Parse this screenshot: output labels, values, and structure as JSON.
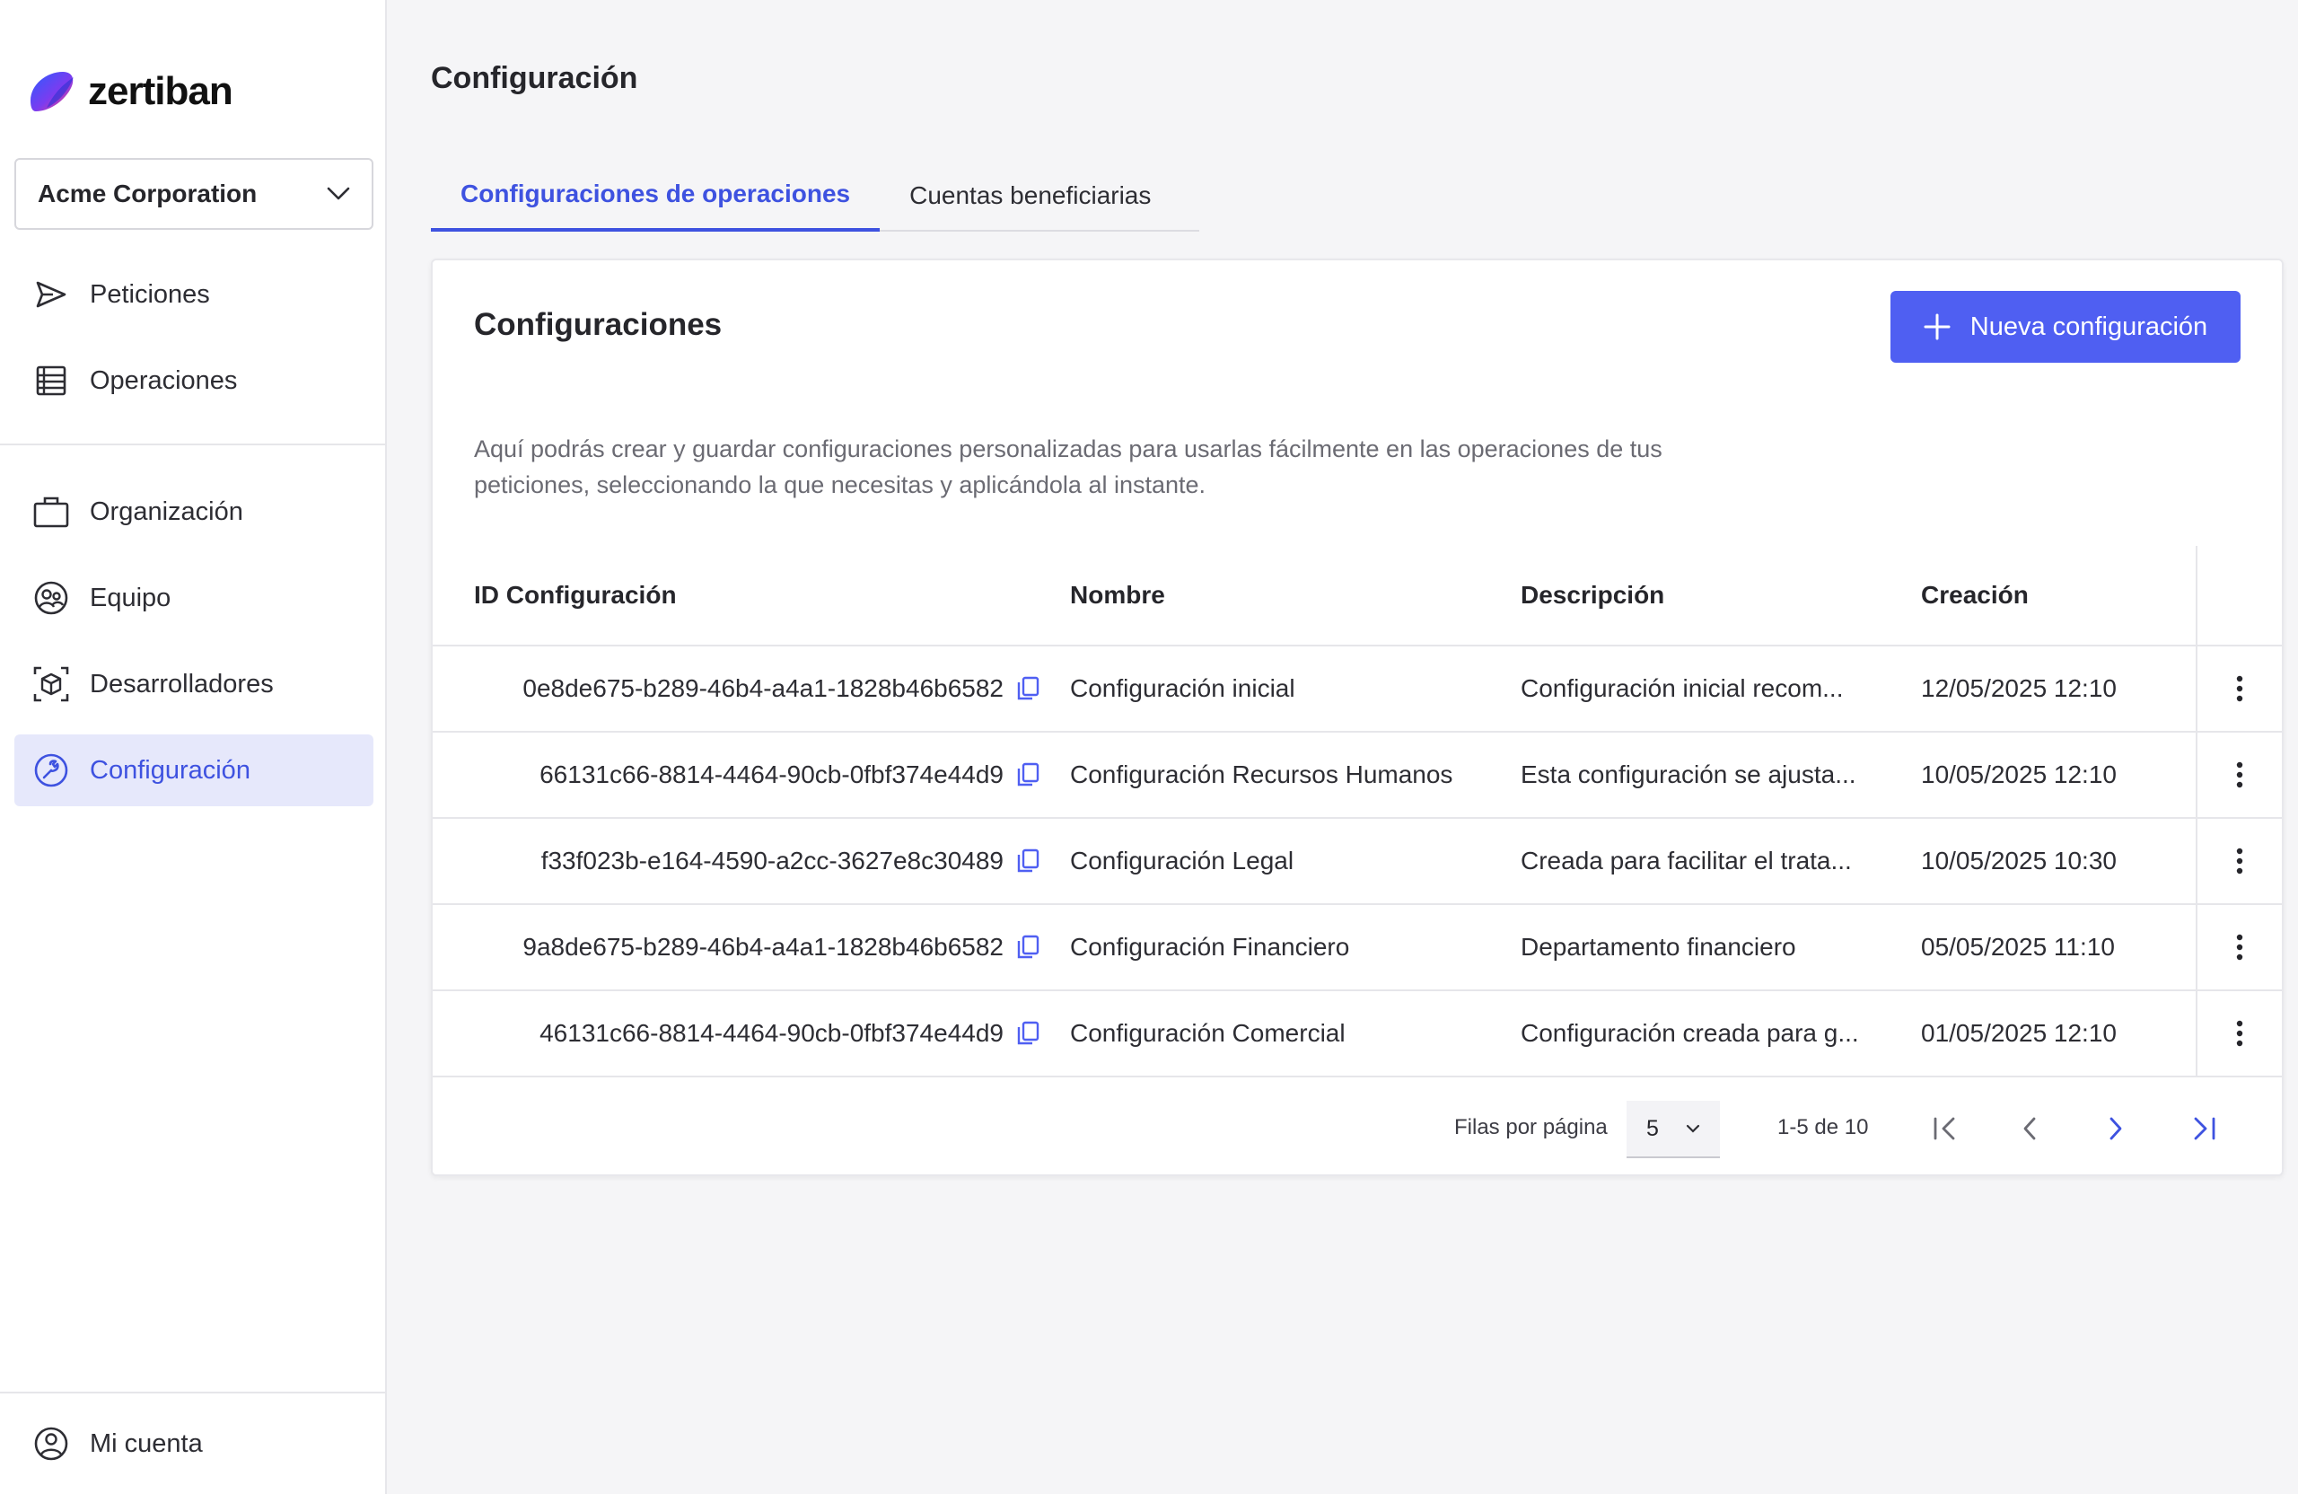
{
  "brand": {
    "name": "zertiban"
  },
  "org_select": {
    "value": "Acme Corporation"
  },
  "nav": {
    "top": [
      {
        "label": "Peticiones",
        "icon": "send-icon"
      },
      {
        "label": "Operaciones",
        "icon": "list-icon"
      }
    ],
    "middle": [
      {
        "label": "Organización",
        "icon": "briefcase-icon"
      },
      {
        "label": "Equipo",
        "icon": "team-icon"
      },
      {
        "label": "Desarrolladores",
        "icon": "cube-icon"
      },
      {
        "label": "Configuración",
        "icon": "wrench-icon",
        "active": true
      }
    ],
    "bottom": {
      "label": "Mi cuenta",
      "icon": "user-circle-icon"
    }
  },
  "page": {
    "title": "Configuración"
  },
  "tabs": [
    {
      "label": "Configuraciones de operaciones",
      "active": true
    },
    {
      "label": "Cuentas beneficiarias",
      "active": false
    }
  ],
  "card": {
    "title": "Configuraciones",
    "new_button": "Nueva configuración",
    "description": "Aquí podrás crear y guardar configuraciones personalizadas para usarlas fácilmente en las operaciones de tus peticiones, seleccionando la que necesitas y aplicándola al instante."
  },
  "table": {
    "headers": {
      "id": "ID Configuración",
      "name": "Nombre",
      "description": "Descripción",
      "created": "Creación"
    },
    "rows": [
      {
        "id": "0e8de675-b289-46b4-a4a1-1828b46b6582",
        "name": "Configuración inicial",
        "description": "Configuración inicial recom...",
        "created": "12/05/2025 12:10"
      },
      {
        "id": "66131c66-8814-4464-90cb-0fbf374e44d9",
        "name": "Configuración Recursos Humanos",
        "description": "Esta configuración se ajusta...",
        "created": "10/05/2025 12:10"
      },
      {
        "id": "f33f023b-e164-4590-a2cc-3627e8c30489",
        "name": "Configuración Legal",
        "description": "Creada para facilitar el trata...",
        "created": "10/05/2025 10:30"
      },
      {
        "id": "9a8de675-b289-46b4-a4a1-1828b46b6582",
        "name": "Configuración Financiero",
        "description": "Departamento financiero",
        "created": "05/05/2025 11:10"
      },
      {
        "id": "46131c66-8814-4464-90cb-0fbf374e44d9",
        "name": "Configuración Comercial",
        "description": "Configuración creada para g...",
        "created": "01/05/2025 12:10"
      }
    ]
  },
  "pagination": {
    "rows_label": "Filas por página",
    "rows_value": "5",
    "range": "1-5 de 10"
  },
  "colors": {
    "accent": "#4f5ff2",
    "active_bg": "#e6e8fb",
    "text": "#26262b"
  }
}
